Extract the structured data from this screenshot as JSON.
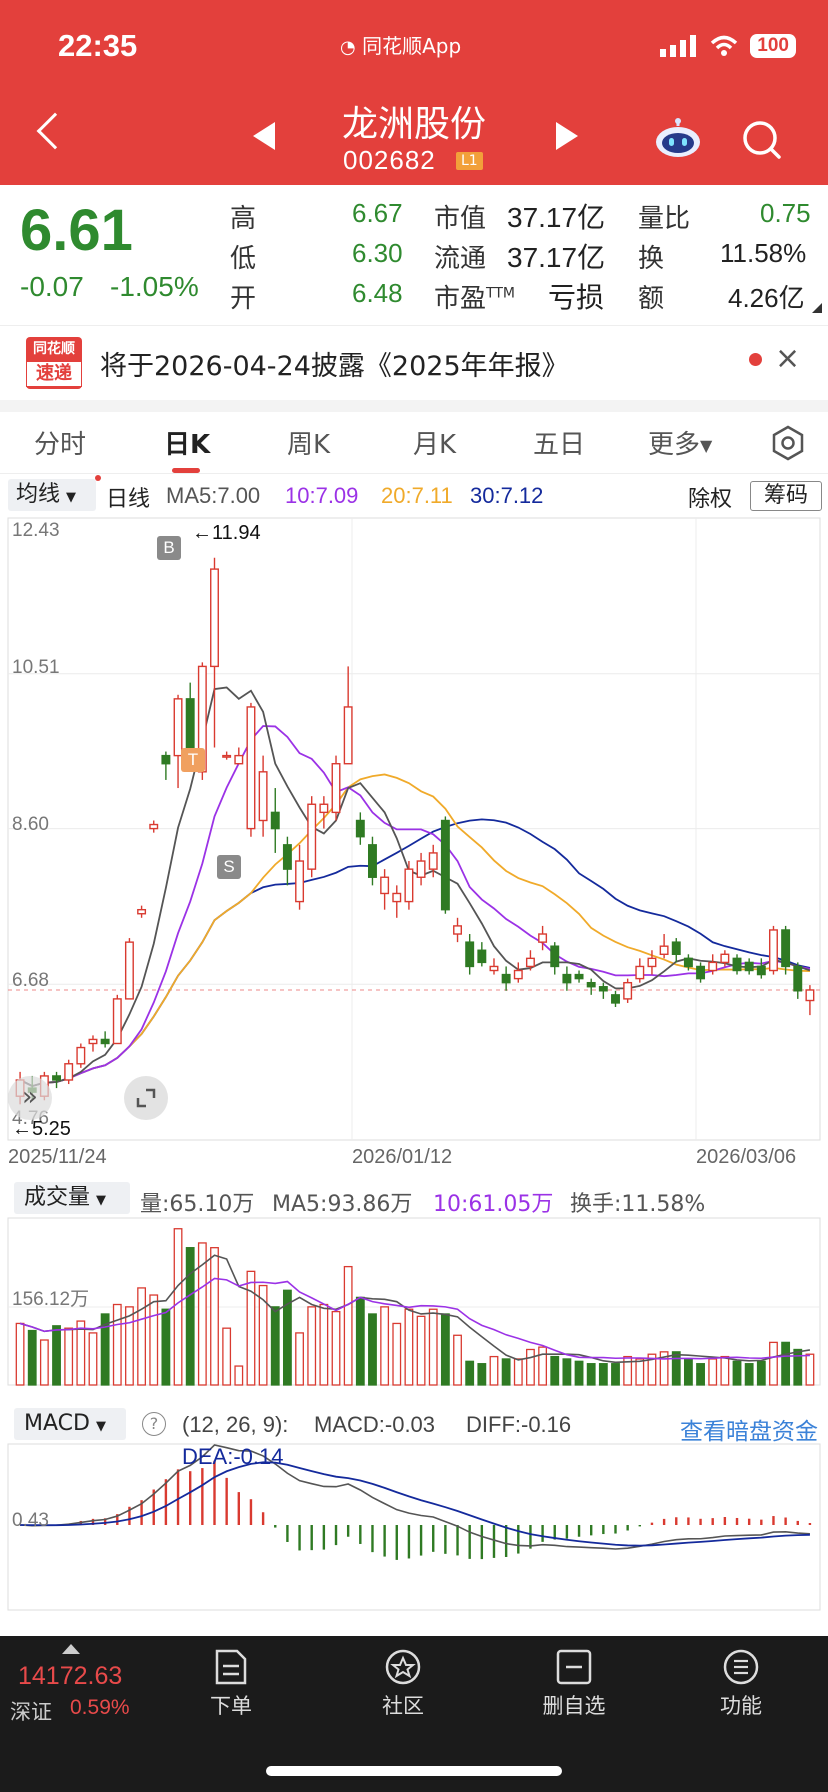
{
  "status": {
    "time": "22:35",
    "app": "同花顺App",
    "battery": "100"
  },
  "stock": {
    "name": "龙洲股份",
    "code": "002682",
    "level": "L1"
  },
  "quote": {
    "price": "6.61",
    "change": "-0.07",
    "change_pct": "-1.05%",
    "high_label": "高",
    "high": "6.67",
    "low_label": "低",
    "low": "6.30",
    "open_label": "开",
    "open": "6.48",
    "mktcap_label": "市值",
    "mktcap": "37.17亿",
    "float_label": "流通",
    "float": "37.17亿",
    "pe_label": "市盈",
    "pe_sup": "TTM",
    "pe": "亏损",
    "vr_label": "量比",
    "vr": "0.75",
    "turn_label": "换",
    "turn": "11.58%",
    "amt_label": "额",
    "amt": "4.26亿"
  },
  "notice": {
    "logo_top": "同花顺",
    "logo_bottom": "速递",
    "text": "将于2026-04-24披露《2025年年报》"
  },
  "tabs": [
    "分时",
    "日K",
    "周K",
    "月K",
    "五日",
    "更多"
  ],
  "legend": {
    "indicator": "均线",
    "period": "日线",
    "ma5": "MA5:7.00",
    "ma10": "10:7.09",
    "ma20": "20:7.11",
    "ma30": "30:7.12",
    "adjust": "除权",
    "chips": "筹码"
  },
  "kline_labels": {
    "y_top": "12.43",
    "y_2": "10.51",
    "y_3": "8.60",
    "y_4": "6.68",
    "y_bottom": "4.76",
    "max_label": "←11.94",
    "min_label": "←5.25",
    "date_start": "2025/11/24",
    "date_mid": "2026/01/12",
    "date_end": "2026/03/06",
    "marker_b": "B",
    "marker_t": "T",
    "marker_s": "S"
  },
  "volume_panel": {
    "indicator": "成交量",
    "vol": "量:65.10万",
    "ma5": "MA5:93.86万",
    "ma10": "10:61.05万",
    "turnover": "换手:11.58%",
    "y_label": "156.12万"
  },
  "macd_panel": {
    "indicator": "MACD",
    "help": "?",
    "params": "(12, 26, 9):",
    "macd": "MACD:-0.03",
    "diff": "DIFF:-0.16",
    "dea": "DEA:-0.14",
    "y_label": "0.43",
    "link": "查看暗盘资金"
  },
  "footer": {
    "index_value": "14172.63",
    "index_name": "深证",
    "index_pct": "0.59%",
    "buttons": [
      "下单",
      "社区",
      "删自选",
      "功能"
    ]
  },
  "colors": {
    "up": "#d93a30",
    "down": "#2f7a23",
    "ma5": "#555555",
    "ma10": "#9b32e6",
    "ma20": "#f0aa2a",
    "ma30": "#142a9c"
  },
  "chart_data": {
    "type": "candlestick",
    "y_axis_ticks": [
      12.43,
      10.51,
      8.6,
      6.68,
      4.76
    ],
    "x_axis_ticks": [
      "2025/11/24",
      "2026/01/12",
      "2026/03/06"
    ],
    "last_close": 6.61,
    "max_annotation": 11.94,
    "min_annotation": 5.25,
    "candles": [
      [
        5.3,
        5.5,
        5.6,
        5.2
      ],
      [
        5.4,
        5.35,
        5.55,
        5.25
      ],
      [
        5.3,
        5.55,
        5.6,
        5.25
      ],
      [
        5.55,
        5.5,
        5.6,
        5.4
      ],
      [
        5.5,
        5.7,
        5.75,
        5.45
      ],
      [
        5.7,
        5.9,
        5.95,
        5.65
      ],
      [
        5.95,
        6.0,
        6.05,
        5.85
      ],
      [
        6.0,
        5.95,
        6.1,
        5.9
      ],
      [
        5.95,
        6.5,
        6.55,
        5.95
      ],
      [
        6.5,
        7.2,
        7.25,
        6.5
      ],
      [
        7.55,
        7.6,
        7.65,
        7.5
      ],
      [
        8.6,
        8.65,
        8.7,
        8.55
      ],
      [
        9.5,
        9.4,
        9.55,
        9.2
      ],
      [
        9.5,
        10.2,
        10.25,
        9.1
      ],
      [
        10.2,
        9.6,
        10.4,
        9.5
      ],
      [
        9.3,
        10.6,
        10.65,
        9.2
      ],
      [
        10.6,
        11.8,
        11.94,
        9.6
      ],
      [
        9.5,
        9.5,
        9.55,
        9.45
      ],
      [
        9.4,
        9.5,
        9.6,
        9.4
      ],
      [
        8.6,
        10.1,
        10.15,
        8.5
      ],
      [
        8.7,
        9.3,
        9.5,
        8.5
      ],
      [
        8.8,
        8.6,
        9.1,
        8.3
      ],
      [
        8.4,
        8.1,
        8.5,
        7.9
      ],
      [
        7.7,
        8.2,
        8.4,
        7.6
      ],
      [
        8.1,
        8.9,
        9.0,
        8.0
      ],
      [
        8.8,
        8.9,
        9.0,
        8.6
      ],
      [
        8.8,
        9.4,
        9.5,
        8.7
      ],
      [
        9.4,
        10.1,
        10.6,
        9.4
      ],
      [
        8.7,
        8.5,
        8.8,
        8.4
      ],
      [
        8.4,
        8.0,
        8.5,
        7.9
      ],
      [
        7.8,
        8.0,
        8.1,
        7.6
      ],
      [
        7.7,
        7.8,
        7.9,
        7.5
      ],
      [
        7.7,
        8.1,
        8.2,
        7.6
      ],
      [
        8.0,
        8.2,
        8.3,
        7.9
      ],
      [
        8.1,
        8.3,
        8.4,
        8.0
      ],
      [
        8.7,
        7.6,
        8.75,
        7.55
      ],
      [
        7.3,
        7.4,
        7.5,
        7.2
      ],
      [
        7.2,
        6.9,
        7.3,
        6.8
      ],
      [
        7.1,
        6.95,
        7.2,
        6.9
      ],
      [
        6.85,
        6.9,
        7.0,
        6.8
      ],
      [
        6.8,
        6.7,
        6.9,
        6.6
      ],
      [
        6.75,
        6.85,
        6.95,
        6.7
      ],
      [
        6.9,
        7.0,
        7.1,
        6.85
      ],
      [
        7.2,
        7.3,
        7.4,
        7.1
      ],
      [
        7.15,
        6.9,
        7.2,
        6.8
      ],
      [
        6.8,
        6.7,
        6.9,
        6.6
      ],
      [
        6.8,
        6.75,
        6.85,
        6.7
      ],
      [
        6.7,
        6.65,
        6.75,
        6.55
      ],
      [
        6.65,
        6.6,
        6.7,
        6.5
      ],
      [
        6.55,
        6.45,
        6.6,
        6.4
      ],
      [
        6.5,
        6.7,
        6.75,
        6.45
      ],
      [
        6.75,
        6.9,
        7.0,
        6.7
      ],
      [
        6.9,
        7.0,
        7.1,
        6.8
      ],
      [
        7.05,
        7.15,
        7.3,
        7.0
      ],
      [
        7.2,
        7.05,
        7.25,
        6.95
      ],
      [
        7.0,
        6.9,
        7.05,
        6.85
      ],
      [
        6.9,
        6.75,
        6.95,
        6.7
      ],
      [
        6.85,
        6.95,
        7.05,
        6.8
      ],
      [
        6.95,
        7.05,
        7.1,
        6.9
      ],
      [
        7.0,
        6.85,
        7.05,
        6.8
      ],
      [
        6.95,
        6.85,
        7.0,
        6.8
      ],
      [
        6.9,
        6.8,
        7.0,
        6.75
      ],
      [
        6.85,
        7.35,
        7.4,
        6.8
      ],
      [
        7.35,
        6.9,
        7.4,
        6.8
      ],
      [
        6.9,
        6.6,
        6.95,
        6.5
      ],
      [
        6.48,
        6.61,
        6.67,
        6.3
      ]
    ],
    "volume": [
      130,
      115,
      95,
      125,
      120,
      135,
      110,
      150,
      170,
      165,
      205,
      190,
      160,
      330,
      290,
      300,
      290,
      120,
      40,
      240,
      210,
      165,
      200,
      110,
      165,
      170,
      155,
      250,
      185,
      150,
      165,
      130,
      160,
      145,
      160,
      150,
      105,
      50,
      45,
      60,
      55,
      55,
      75,
      80,
      60,
      55,
      50,
      45,
      45,
      45,
      60,
      55,
      65,
      70,
      70,
      55,
      45,
      55,
      60,
      50,
      45,
      50,
      90,
      90,
      75,
      65
    ]
  }
}
